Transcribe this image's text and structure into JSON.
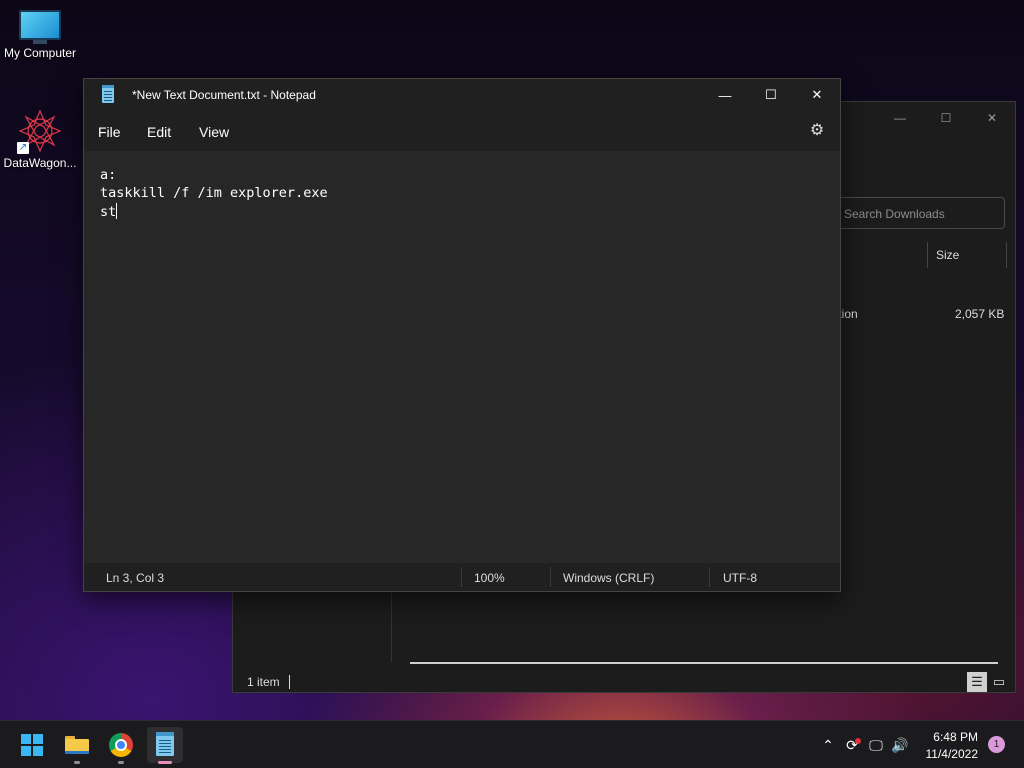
{
  "desktop": {
    "icons": [
      {
        "label": "My Computer",
        "icon": "computer-monitor-icon"
      },
      {
        "label": "DataWagon...",
        "icon": "datawagon-logo-icon"
      }
    ]
  },
  "explorer": {
    "search_placeholder": "Search Downloads",
    "column_size": "Size",
    "row_type_fragment": "ication",
    "row_size": "2,057 KB",
    "status_count": "1 item"
  },
  "notepad": {
    "title": "*New Text Document.txt - Notepad",
    "menu": [
      "File",
      "Edit",
      "View"
    ],
    "lines": [
      "a:",
      "taskkill /f /im explorer.exe",
      "st"
    ],
    "status": {
      "position": "Ln 3, Col 3",
      "zoom": "100%",
      "line_ending": "Windows (CRLF)",
      "encoding": "UTF-8"
    }
  },
  "window_controls": {
    "minimize": "—",
    "maximize": "☐",
    "close": "✕"
  },
  "taskbar": {
    "apps": [
      "start",
      "file-explorer",
      "chrome",
      "notepad"
    ],
    "clock_time": "6:48 PM",
    "clock_date": "11/4/2022",
    "notification_count": "1"
  },
  "colors": {
    "accent_blue": "#3ab8f5",
    "notepad_bg": "#272727",
    "titlebar_bg": "#202020",
    "taskbar_bg": "#1b1b1d",
    "notification_badge": "#d89ad8"
  }
}
